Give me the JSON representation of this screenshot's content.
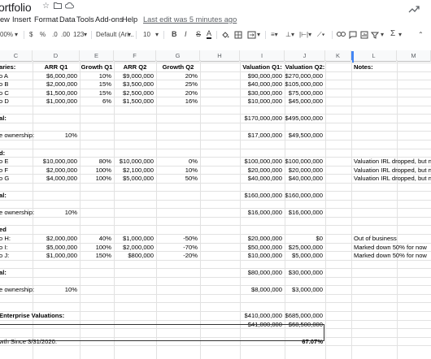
{
  "title": {
    "text": "ortfolio",
    "star_icon": "star-icon",
    "folder_icon": "folder-icon",
    "cloud_icon": "cloud-icon",
    "trend_icon": "trending-up-icon"
  },
  "menu": {
    "items": [
      "ew",
      "Insert",
      "Format",
      "Data",
      "Tools",
      "Add-ons",
      "Help"
    ],
    "last_edit": "Last edit was 5 minutes ago"
  },
  "toolbar": {
    "zoom": "00%",
    "currency": "$",
    "percent": "%",
    "dec_decrease": ".0",
    "dec_increase": ".00",
    "more_formats": "123",
    "font": "Default (Ari...",
    "font_size": "10",
    "bold": "B",
    "italic": "I",
    "strike": "S",
    "text_color": "A",
    "fill_icon": "paint-bucket-icon",
    "borders_icon": "borders-icon",
    "merge_icon": "merge-cells-icon",
    "halign_icon": "align-left-icon",
    "valign_icon": "vertical-align-icon",
    "wrap_icon": "text-wrap-icon",
    "rotate_icon": "text-rotate-icon",
    "link_icon": "link-icon",
    "comment_icon": "comment-icon",
    "chart_icon": "chart-icon",
    "filter_icon": "filter-icon",
    "functions": "Σ"
  },
  "columns": [
    "C",
    "D",
    "E",
    "F",
    "G",
    "H",
    "I",
    "J",
    "K",
    "L",
    "M"
  ],
  "rows": [
    {
      "c": "aries:",
      "d": "ARR Q1",
      "e": "Growth Q1",
      "f": "ARR Q2",
      "g": "Growth Q2",
      "i": "Valuation Q1:",
      "j": "Valuation Q2:",
      "l": "Notes:",
      "bold": true
    },
    {
      "c": "o A",
      "d": "$6,000,000",
      "e": "10%",
      "f": "$9,000,000",
      "g": "20%",
      "i": "$90,000,000",
      "j": "$270,000,000"
    },
    {
      "c": "o B",
      "d": "$2,000,000",
      "e": "15%",
      "f": "$3,500,000",
      "g": "25%",
      "i": "$40,000,000",
      "j": "$105,000,000"
    },
    {
      "c": "o C",
      "d": "$1,500,000",
      "e": "15%",
      "f": "$2,500,000",
      "g": "20%",
      "i": "$30,000,000",
      "j": "$75,000,000"
    },
    {
      "c": "o D",
      "d": "$1,000,000",
      "e": "6%",
      "f": "$1,500,000",
      "g": "16%",
      "i": "$10,000,000",
      "j": "$45,000,000"
    },
    {},
    {
      "c": "al:",
      "i": "$170,000,000",
      "j": "$495,000,000",
      "bold_c": true
    },
    {},
    {
      "c": "e ownership:",
      "d": "10%",
      "i": "$17,000,000",
      "j": "$49,500,000"
    },
    {},
    {
      "c": "d:",
      "bold_c": true
    },
    {
      "c": "o E",
      "d": "$10,000,000",
      "e": "80%",
      "f": "$10,000,000",
      "g": "0%",
      "i": "$100,000,000",
      "j": "$100,000,000",
      "l": "Valuation IRL dropped, but not m"
    },
    {
      "c": "o F",
      "d": "$2,000,000",
      "e": "100%",
      "f": "$2,100,000",
      "g": "10%",
      "i": "$20,000,000",
      "j": "$20,000,000",
      "l": "Valuation IRL dropped, but not m"
    },
    {
      "c": "o G",
      "d": "$4,000,000",
      "e": "100%",
      "f": "$5,000,000",
      "g": "50%",
      "i": "$40,000,000",
      "j": "$40,000,000",
      "l": "Valuation IRL dropped, but not m"
    },
    {},
    {
      "c": "al:",
      "i": "$160,000,000",
      "j": "$160,000,000",
      "bold_c": true
    },
    {},
    {
      "c": "e ownership:",
      "d": "10%",
      "i": "$16,000,000",
      "j": "$16,000,000"
    },
    {},
    {
      "c": "ed",
      "bold_c": true
    },
    {
      "c": "o H:",
      "d": "$2,000,000",
      "e": "40%",
      "f": "$1,000,000",
      "g": "-50%",
      "i": "$20,000,000",
      "j": "$0",
      "l": "Out of business"
    },
    {
      "c": "o I:",
      "d": "$5,000,000",
      "e": "100%",
      "f": "$2,000,000",
      "g": "-70%",
      "i": "$50,000,000",
      "j": "$25,000,000",
      "l": "Marked down 50% for now"
    },
    {
      "c": "o J:",
      "d": "$1,000,000",
      "e": "150%",
      "f": "$800,000",
      "g": "-20%",
      "i": "$10,000,000",
      "j": "$5,000,000",
      "l": "Marked down 50% for now"
    },
    {},
    {
      "c": "al:",
      "i": "$80,000,000",
      "j": "$30,000,000",
      "bold_c": true
    },
    {},
    {
      "c": "e ownership:",
      "d": "10%",
      "i": "$8,000,000",
      "j": "$3,000,000"
    },
    {},
    {},
    {
      "c": "Enterprise Valuations:",
      "i": "$410,000,000",
      "j": "$685,000,000",
      "bold_c": true
    },
    {
      "i": "$41,000,000",
      "j": "$68,500,000"
    },
    {},
    {
      "c": "wth Since 3/31/2020:",
      "j": "67.07%",
      "bold_j": true
    }
  ]
}
